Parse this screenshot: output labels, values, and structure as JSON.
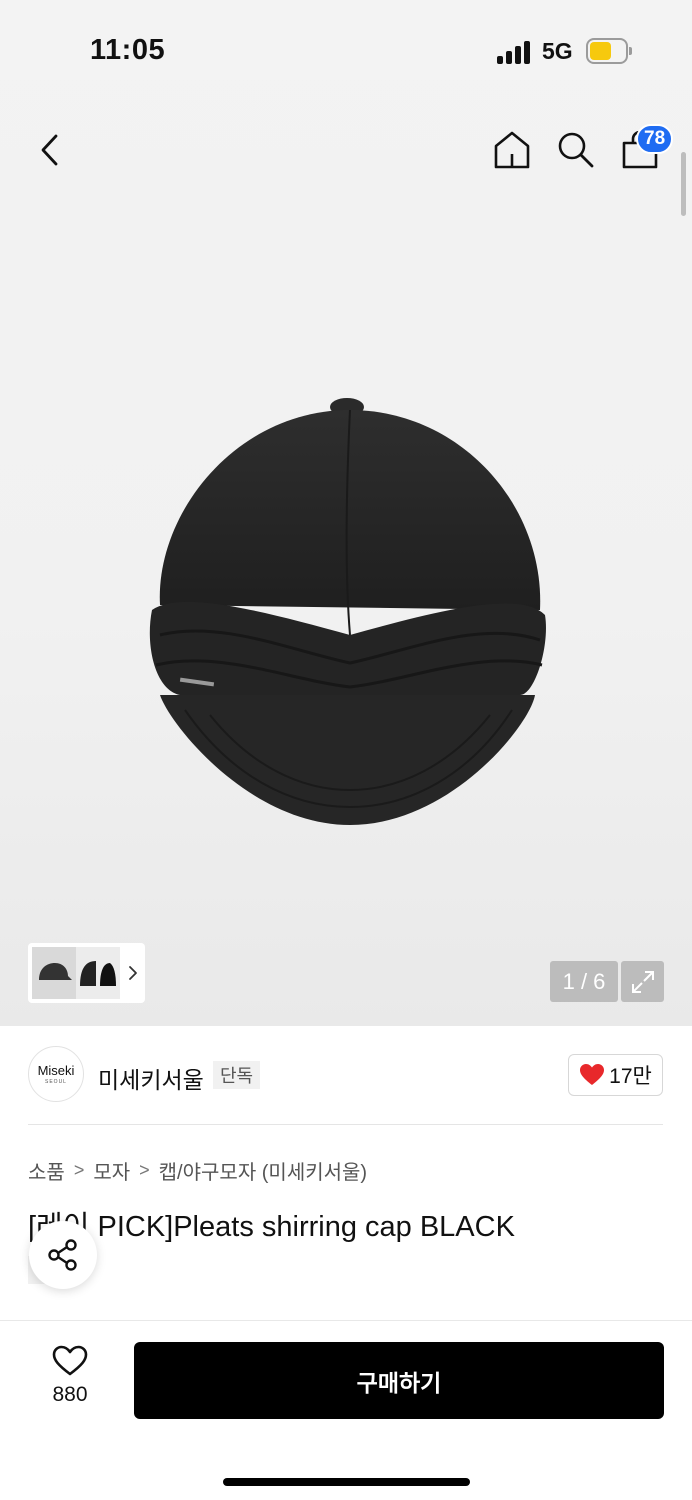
{
  "status_bar": {
    "time": "11:05",
    "network": "5G",
    "battery_color": "#f6c90e"
  },
  "nav": {
    "back_icon": "chevron-left-icon",
    "home_icon": "home-icon",
    "search_icon": "search-icon",
    "cart_icon": "shopping-bag-icon",
    "cart_count": "78",
    "badge_color": "#1f6cf2"
  },
  "gallery": {
    "counter": "1 / 6",
    "expand_icon": "expand-icon",
    "thumbs_next_icon": "chevron-right-icon"
  },
  "brand": {
    "logo_text": "Miseki",
    "logo_subtext": "SEOUL",
    "name": "미세키서울",
    "exclusive_tag": "단독",
    "like_count": "17만",
    "like_icon": "heart-filled-icon",
    "heart_color": "#e8282b"
  },
  "breadcrumb": [
    "소품",
    "모자",
    "캡/야구모자 (미세키서울)"
  ],
  "product": {
    "title": "[레이 PICK]Pleats shirring cap BLACK",
    "tags": [
      "단독"
    ]
  },
  "share": {
    "icon": "share-icon"
  },
  "bottom_bar": {
    "wish_icon": "heart-outline-icon",
    "wish_count": "880",
    "buy_label": "구매하기"
  }
}
